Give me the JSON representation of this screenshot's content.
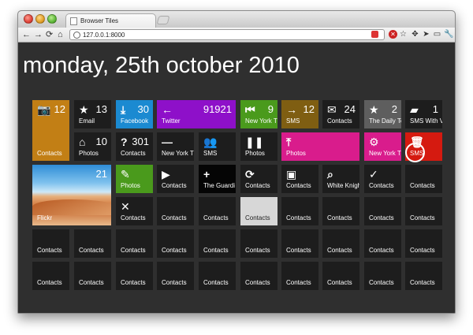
{
  "window": {
    "tab_title": "Browser Tiles",
    "url": "127.0.0.1:8000"
  },
  "heading": "monday, 25th october 2010",
  "colors": {
    "orange": "#c27f15",
    "blue": "#1b8ad1",
    "purple": "#8e10c9",
    "green": "#4a9a1c",
    "magenta": "#d91c8c",
    "red": "#d51a10",
    "olive": "#7f5e12",
    "dark": "#1d1d1d",
    "grey": "#5e5e5e",
    "light": "#d7d7d7",
    "black": "#050505"
  },
  "tiles": [
    {
      "icon": "camera-icon",
      "glyph": "📷",
      "count": "12",
      "label": "Contacts",
      "color": "orange"
    },
    {
      "icon": "star-icon",
      "glyph": "★",
      "count": "13",
      "label": "Email",
      "color": "dark"
    },
    {
      "icon": "download-icon",
      "glyph": "⤓",
      "count": "30",
      "label": "Facebook",
      "color": "blue"
    },
    {
      "icon": "arrow-left-icon",
      "glyph": "←",
      "count": "91921",
      "label": "Twitter",
      "color": "purple"
    },
    {
      "icon": "skip-back-icon",
      "glyph": "⏮",
      "count": "9",
      "label": "New York T",
      "color": "green"
    },
    {
      "icon": "arrow-right-icon",
      "glyph": "→",
      "count": "12",
      "label": "SMS",
      "color": "olive"
    },
    {
      "icon": "envelope-icon",
      "glyph": "✉",
      "count": "24",
      "label": "Contacts",
      "color": "dark"
    },
    {
      "icon": "star-icon",
      "glyph": "★",
      "count": "2",
      "label": "The Daily Te",
      "color": "grey"
    },
    {
      "icon": "book-icon",
      "glyph": "▰",
      "count": "1",
      "label": "SMS With V",
      "color": "dark"
    },
    {
      "icon": "home-icon",
      "glyph": "⌂",
      "count": "10",
      "label": "Photos",
      "color": "dark"
    },
    {
      "icon": "question-icon",
      "glyph": "?",
      "count": "301",
      "label": "Contacts",
      "color": "dark"
    },
    {
      "icon": "minus-icon",
      "glyph": "—",
      "count": "",
      "label": "New York T",
      "color": "dark"
    },
    {
      "icon": "people-icon",
      "glyph": "👥",
      "count": "",
      "label": "SMS",
      "color": "dark"
    },
    {
      "icon": "pause-icon",
      "glyph": "❚❚",
      "count": "",
      "label": "Photos",
      "color": "dark"
    },
    {
      "icon": "upload-icon",
      "glyph": "⤒",
      "count": "",
      "label": "Photos",
      "color": "magenta"
    },
    {
      "icon": "gear-icon",
      "glyph": "⚙",
      "count": "",
      "label": "New York T",
      "color": "magenta"
    },
    {
      "icon": "trash-icon",
      "glyph": "🗑",
      "count": "",
      "label": "SMS",
      "color": "red"
    },
    {
      "icon": "photo-icon",
      "glyph": "",
      "count": "21",
      "label": "Flickr",
      "color": "photo"
    },
    {
      "icon": "pencil-icon",
      "glyph": "✎",
      "count": "",
      "label": "Photos",
      "color": "green"
    },
    {
      "icon": "play-icon",
      "glyph": "▶",
      "count": "",
      "label": "Contacts",
      "color": "dark"
    },
    {
      "icon": "plus-icon",
      "glyph": "+",
      "count": "",
      "label": "The Guardi",
      "color": "black"
    },
    {
      "icon": "refresh-icon",
      "glyph": "⟳",
      "count": "",
      "label": "Contacts",
      "color": "dark"
    },
    {
      "icon": "save-icon",
      "glyph": "▣",
      "count": "",
      "label": "Contacts",
      "color": "dark"
    },
    {
      "icon": "search-icon",
      "glyph": "⌕",
      "count": "",
      "label": "White Knigh",
      "color": "dark"
    },
    {
      "icon": "check-icon",
      "glyph": "✓",
      "count": "",
      "label": "Contacts",
      "color": "dark"
    },
    {
      "icon": "",
      "glyph": "",
      "count": "",
      "label": "Contacts",
      "color": "dark"
    },
    {
      "icon": "close-icon",
      "glyph": "✕",
      "count": "",
      "label": "Contacts",
      "color": "dark"
    },
    {
      "icon": "",
      "glyph": "",
      "count": "",
      "label": "Contacts",
      "color": "dark"
    },
    {
      "icon": "",
      "glyph": "",
      "count": "",
      "label": "Contacts",
      "color": "dark"
    },
    {
      "icon": "",
      "glyph": "",
      "count": "",
      "label": "Contacts",
      "color": "light"
    },
    {
      "icon": "",
      "glyph": "",
      "count": "",
      "label": "Contacts",
      "color": "dark"
    },
    {
      "icon": "",
      "glyph": "",
      "count": "",
      "label": "Contacts",
      "color": "dark"
    },
    {
      "icon": "",
      "glyph": "",
      "count": "",
      "label": "Contacts",
      "color": "dark"
    },
    {
      "icon": "",
      "glyph": "",
      "count": "",
      "label": "Contacts",
      "color": "dark"
    },
    {
      "icon": "",
      "glyph": "",
      "count": "",
      "label": "Contacts",
      "color": "dark"
    },
    {
      "icon": "",
      "glyph": "",
      "count": "",
      "label": "Contacts",
      "color": "dark"
    },
    {
      "icon": "",
      "glyph": "",
      "count": "",
      "label": "Contacts",
      "color": "dark"
    },
    {
      "icon": "",
      "glyph": "",
      "count": "",
      "label": "Contacts",
      "color": "dark"
    },
    {
      "icon": "",
      "glyph": "",
      "count": "",
      "label": "Contacts",
      "color": "dark"
    },
    {
      "icon": "",
      "glyph": "",
      "count": "",
      "label": "Contacts",
      "color": "dark"
    },
    {
      "icon": "",
      "glyph": "",
      "count": "",
      "label": "Contacts",
      "color": "dark"
    },
    {
      "icon": "",
      "glyph": "",
      "count": "",
      "label": "Contacts",
      "color": "dark"
    },
    {
      "icon": "",
      "glyph": "",
      "count": "",
      "label": "Contacts",
      "color": "dark"
    },
    {
      "icon": "",
      "glyph": "",
      "count": "",
      "label": "Contacts",
      "color": "dark"
    },
    {
      "icon": "",
      "glyph": "",
      "count": "",
      "label": "Contacts",
      "color": "dark"
    },
    {
      "icon": "",
      "glyph": "",
      "count": "",
      "label": "Contacts",
      "color": "dark"
    },
    {
      "icon": "",
      "glyph": "",
      "count": "",
      "label": "Contacts",
      "color": "dark"
    },
    {
      "icon": "",
      "glyph": "",
      "count": "",
      "label": "Contacts",
      "color": "dark"
    },
    {
      "icon": "",
      "glyph": "",
      "count": "",
      "label": "Contacts",
      "color": "dark"
    },
    {
      "icon": "",
      "glyph": "",
      "count": "",
      "label": "Contacts",
      "color": "dark"
    },
    {
      "icon": "",
      "glyph": "",
      "count": "",
      "label": "Contacts",
      "color": "dark"
    },
    {
      "icon": "",
      "glyph": "",
      "count": "",
      "label": "Contacts",
      "color": "dark"
    },
    {
      "icon": "",
      "glyph": "",
      "count": "",
      "label": "Contacts",
      "color": "dark"
    },
    {
      "icon": "",
      "glyph": "",
      "count": "",
      "label": "Contacts",
      "color": "dark"
    },
    {
      "icon": "",
      "glyph": "",
      "count": "",
      "label": "Contacts",
      "color": "dark"
    }
  ]
}
